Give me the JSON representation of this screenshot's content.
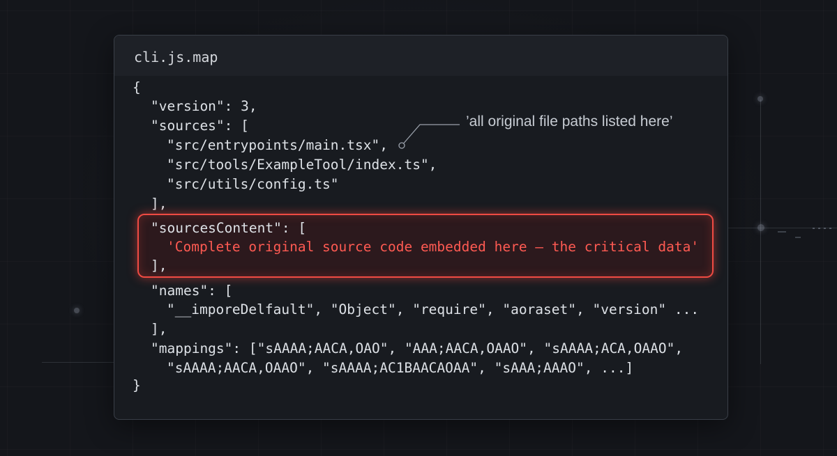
{
  "file": {
    "name": "cli.js.map"
  },
  "code": {
    "open_brace": "{",
    "version_line": "\"version\": 3,",
    "sources_key": "\"sources\": [",
    "sources": [
      "\"src/entrypoints/main.tsx\",",
      "\"src/tools/ExampleTool/index.ts\",",
      "\"src/utils/config.ts\""
    ],
    "sources_close": "],",
    "sources_content_key": "\"sourcesContent\": [",
    "sources_content_value": "'Complete original source code embedded here — the critical data'",
    "sources_content_close": "],",
    "names_key": "\"names\": [",
    "names_value": "\"__imporeDelfault\", \"Object\", \"require\", \"aoraset\", \"version\" ...",
    "names_close": "],",
    "mappings_line1": "\"mappings\": [\"sAAAA;AACA,OAO\", \"AAA;AACA,OAAO\", \"sAAAA;ACA,OAAO\",",
    "mappings_line2": "\"sAAAA;AACA,OAAO\", \"sAAAA;AC1BAACAOAA\", \"sAAA;AAAO\", ...]",
    "close_brace": "}"
  },
  "annotation": {
    "text": "’all original file paths listed here’"
  },
  "colors": {
    "background": "#14161b",
    "panel": "#181b20",
    "highlight": "#f04b43",
    "highlight_text": "#ff5a52",
    "code_text": "#dde1e6",
    "annotation_text": "#c7ccd3"
  }
}
